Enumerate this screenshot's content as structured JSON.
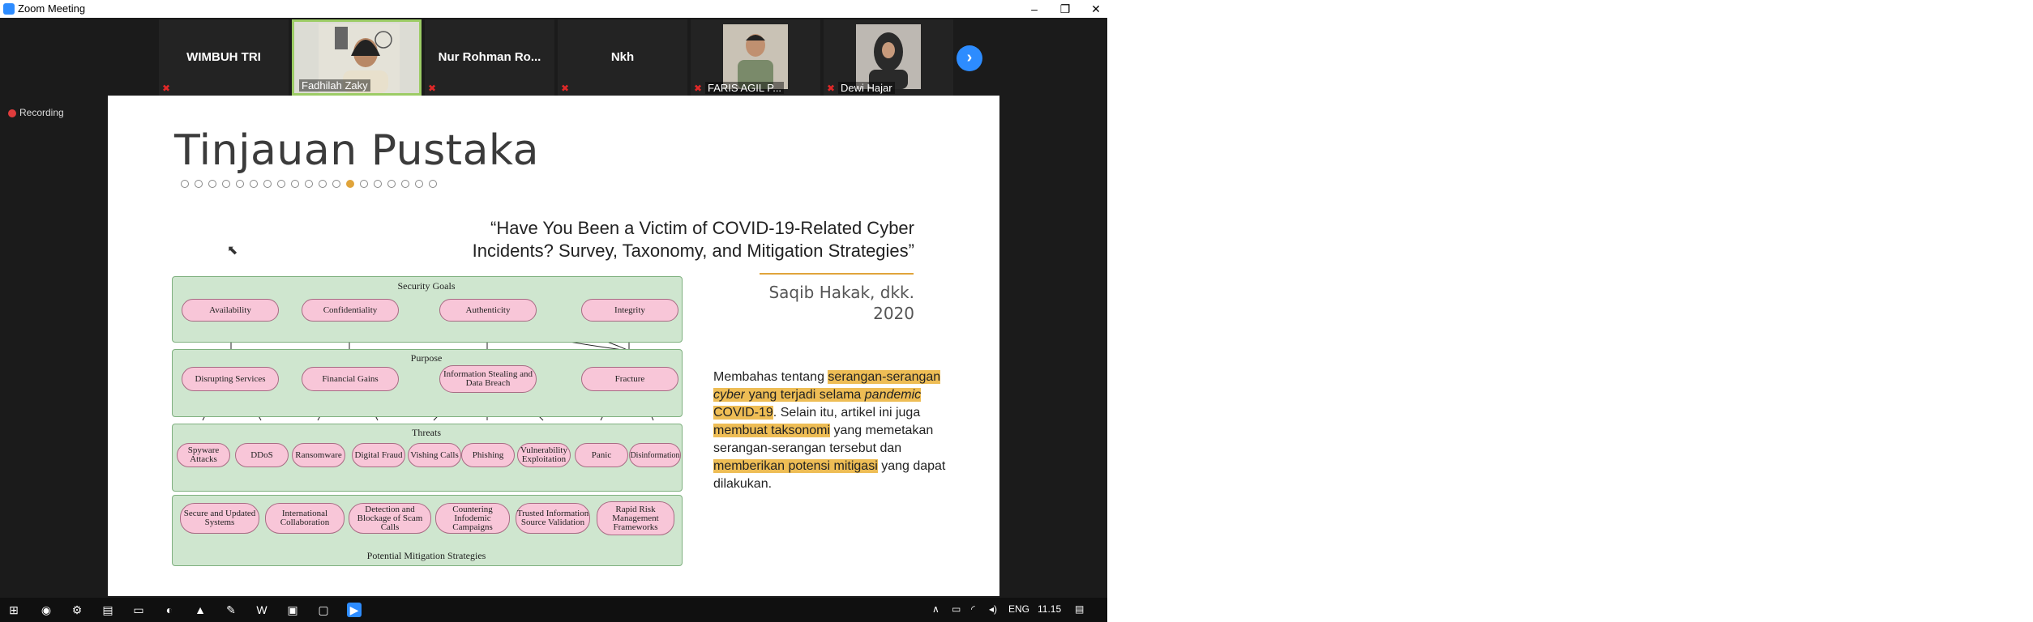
{
  "window": {
    "title": "Zoom Meeting",
    "minimize": "–",
    "restore": "❐",
    "close": "✕"
  },
  "participants": [
    {
      "name": "WIMBUH TRI"
    },
    {
      "name": "Fadhilah Zaky"
    },
    {
      "name": "Nur Rohman Ro..."
    },
    {
      "name": "Nkh"
    },
    {
      "name": "FARIS AGIL P..."
    },
    {
      "name": "Dewi Hajar"
    }
  ],
  "next_label": "›",
  "recording": "Recording",
  "slide": {
    "title": "Tinjauan Pustaka",
    "quote": "“Have You Been a Victim of COVID-19-Related Cyber Incidents? Survey, Taxonomy, and Mitigation Strategies”",
    "author": "Saqib Hakak, dkk.",
    "year": "2020",
    "desc": {
      "p1": "Membahas tentang ",
      "h1a": "serangan-serangan",
      "h1b_italic": "cyber",
      "h1c": " yang terjadi selama ",
      "h1d_italic": "pandemic",
      "h1e": "COVID-19",
      "p2": ". Selain itu, artikel ini juga ",
      "h2": "membuat taksonomi",
      "p3": " yang memetakan serangan-serangan tersebut dan ",
      "h3": "memberikan potensi mitigasi",
      "p4": " yang dapat dilakukan."
    },
    "diagram": {
      "security_goals_title": "Security Goals",
      "security_goals": [
        "Availability",
        "Confidentiality",
        "Authenticity",
        "Integrity"
      ],
      "purpose_title": "Purpose",
      "purpose": [
        "Disrupting Services",
        "Financial Gains",
        "Information Stealing and Data Breach",
        "Fracture"
      ],
      "threats_title": "Threats",
      "threats": [
        "Spyware Attacks",
        "DDoS",
        "Ransomware",
        "Digital Fraud",
        "Vishing Calls",
        "Phishing",
        "Vulnerability Exploitation",
        "Panic",
        "Disinformation"
      ],
      "mitigation_title": "Potential Mitigation  Strategies",
      "mitigation": [
        "Secure and Updated Systems",
        "International Collaboration",
        "Detection and Blockage of Scam Calls",
        "Countering Infodemic Campaigns",
        "Trusted Information Source Validation",
        "Rapid Risk Management Frameworks"
      ]
    }
  },
  "taskbar": {
    "lang": "ENG",
    "time": "11.15"
  }
}
